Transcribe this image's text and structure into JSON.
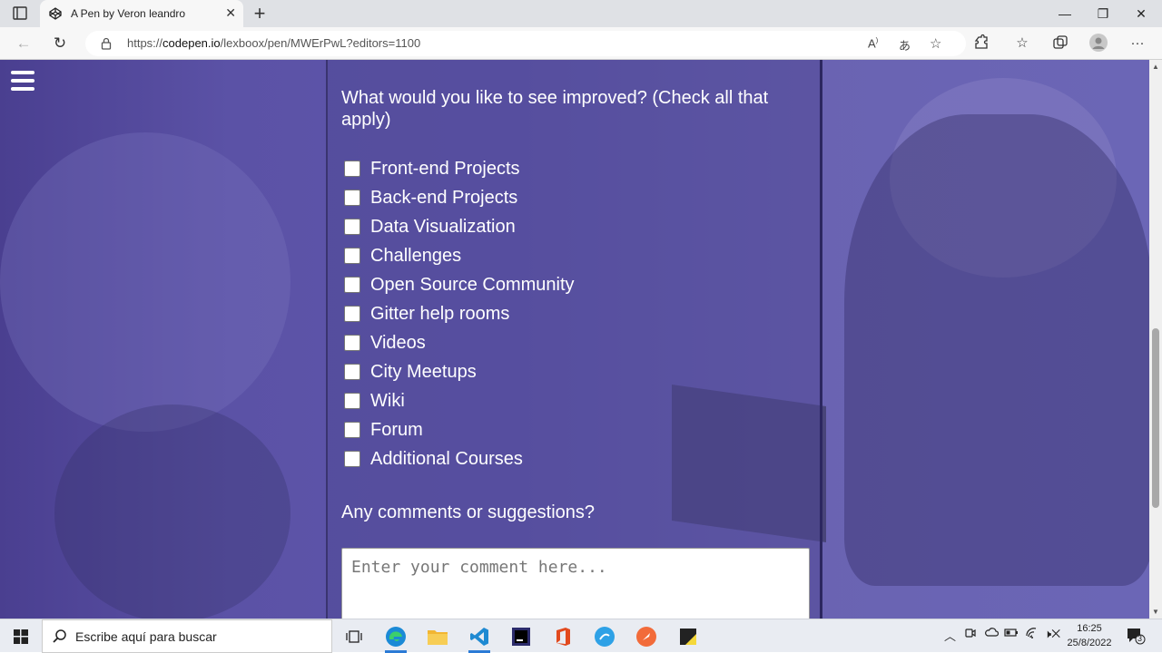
{
  "browser": {
    "tab_title": "A Pen by Veron leandro",
    "url_prefix": "https://",
    "url_domain": "codepen.io",
    "url_path": "/lexboox/pen/MWErPwL?editors=1100"
  },
  "form": {
    "question": "What would you like to see improved? (Check all that apply)",
    "options": [
      "Front-end Projects",
      "Back-end Projects",
      "Data Visualization",
      "Challenges",
      "Open Source Community",
      "Gitter help rooms",
      "Videos",
      "City Meetups",
      "Wiki",
      "Forum",
      "Additional Courses"
    ],
    "comments_label": "Any comments or suggestions?",
    "comment_placeholder": "Enter your comment here..."
  },
  "taskbar": {
    "search_placeholder": "Escribe aquí para buscar",
    "time": "16:25",
    "date": "25/8/2022",
    "notification_count": "3"
  },
  "colors": {
    "accent": "#2b7bd6",
    "page_overlay": "#5e56ab"
  }
}
